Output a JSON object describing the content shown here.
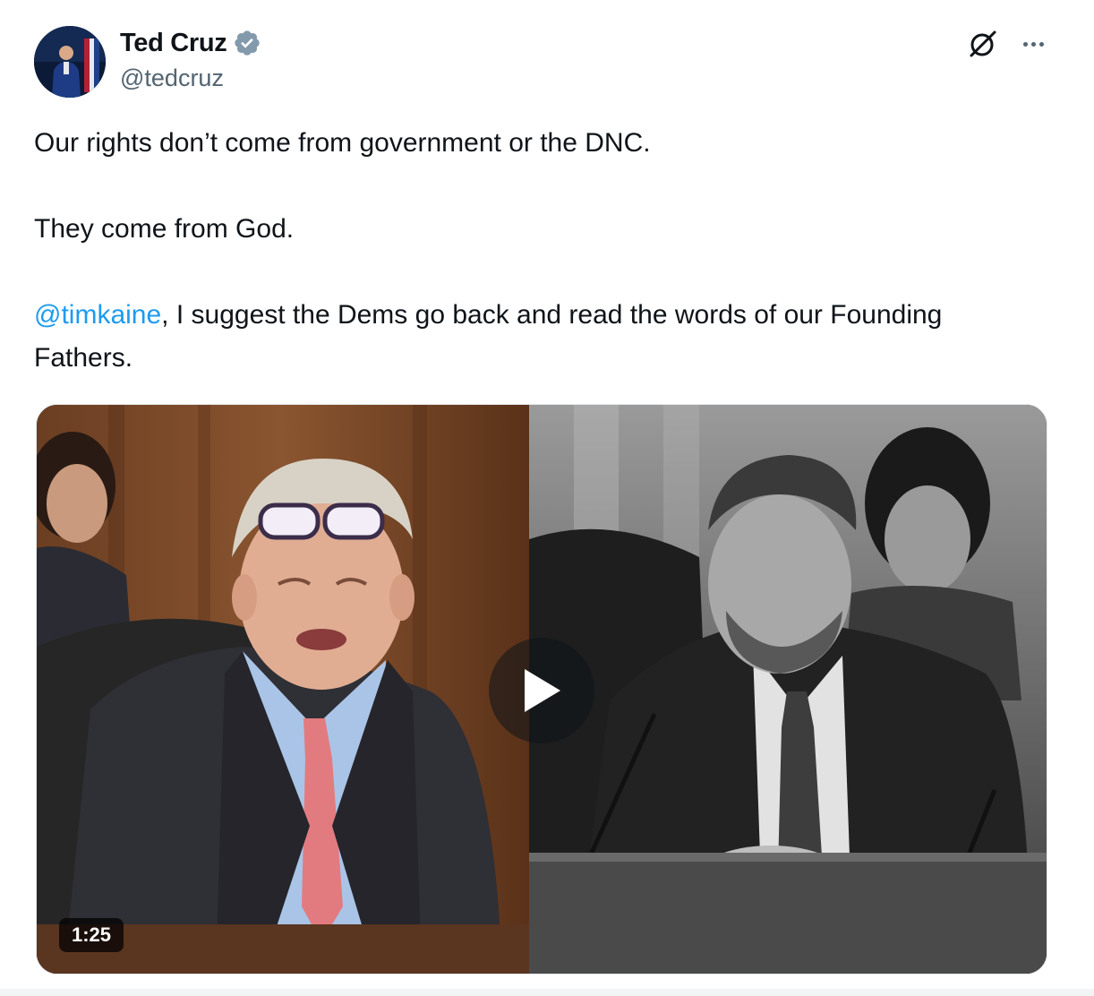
{
  "author": {
    "display_name": "Ted Cruz",
    "handle": "@tedcruz",
    "verified": true,
    "verified_color": "#829aab"
  },
  "header_icons": {
    "grok": "grok-icon",
    "more": "more-options-icon"
  },
  "tweet": {
    "line1": "Our rights don’t come from government or the DNC.",
    "line2": "They come from God.",
    "mention": "@timkaine",
    "line3_rest": ", I suggest the Dems go back and read the words of our Founding Fathers."
  },
  "media": {
    "type": "video",
    "duration": "1:25",
    "play_icon": "play-icon"
  },
  "colors": {
    "text": "#0f1419",
    "secondary": "#536471",
    "link": "#1d9bf0"
  }
}
